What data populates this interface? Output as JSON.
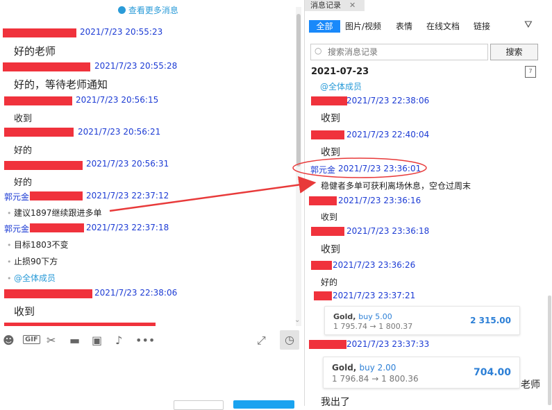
{
  "left": {
    "view_more": "查看更多消息",
    "messages": [
      {
        "time": "2021/7/23 20:55:23",
        "text": "好的老师"
      },
      {
        "time": "2021/7/23 20:55:28",
        "text": "好的，等待老师通知"
      },
      {
        "time": "2021/7/23 20:56:15",
        "text": "收到"
      },
      {
        "time": "2021/7/23 20:56:21",
        "text": "好的"
      },
      {
        "time": "2021/7/23 20:56:31",
        "text": "好的"
      },
      {
        "sender": "郭元金",
        "time": "2021/7/23 22:37:12",
        "text": "建议1897继续跟进多单"
      },
      {
        "sender": "郭元金",
        "time": "2021/7/23 22:37:18",
        "lines": [
          "目标1803不变",
          "止损90下方",
          "@全体成员"
        ]
      },
      {
        "time": "2021/7/23 22:38:06",
        "text": "收到"
      }
    ],
    "toolbar_icons": [
      "emoji-icon",
      "gif-icon",
      "scissors-icon",
      "folder-icon",
      "image-icon",
      "bell-icon",
      "more-icon",
      "expand-icon",
      "history-icon"
    ],
    "toolbar_gif": "GIF"
  },
  "right": {
    "header_title": "消息记录",
    "tabs": [
      "全部",
      "图片/视频",
      "表情",
      "在线文档",
      "链接"
    ],
    "active_tab": "全部",
    "search_placeholder": "搜索消息记录",
    "search_button": "搜索",
    "date": "2021-07-23",
    "messages": [
      {
        "text": "@全体成员"
      },
      {
        "time": "2021/7/23 22:38:06",
        "text": "收到"
      },
      {
        "time": "2021/7/23 22:40:04",
        "text": "收到"
      },
      {
        "sender": "郭元金",
        "time": "2021/7/23 23:36:01",
        "text": "稳健者多单可获利离场休息，空仓过周末"
      },
      {
        "time": "2021/7/23 23:36:16",
        "text": "收到"
      },
      {
        "time": "2021/7/23 23:36:18",
        "text": "收到"
      },
      {
        "time": "2021/7/23 23:36:26",
        "text": "好的"
      },
      {
        "time": "2021/7/23 23:37:21"
      },
      {
        "time": "2021/7/23 23:37:33"
      }
    ],
    "cards": [
      {
        "asset": "Gold,",
        "action": "buy 5.00",
        "from": "1 795.74",
        "arrow": "→",
        "to": "1 800.37",
        "value": "2 315.00"
      },
      {
        "asset": "Gold,",
        "action": "buy 2.00",
        "from": "1 796.84",
        "arrow": "→",
        "to": "1 800.36",
        "value": "704.00"
      }
    ],
    "side_text": "老师",
    "last_text": "我出了"
  },
  "colors": {
    "redact": "#f0323c",
    "link_blue": "#1c3bd4",
    "accent": "#2a9bd8",
    "arrow": "#e83a3a"
  }
}
